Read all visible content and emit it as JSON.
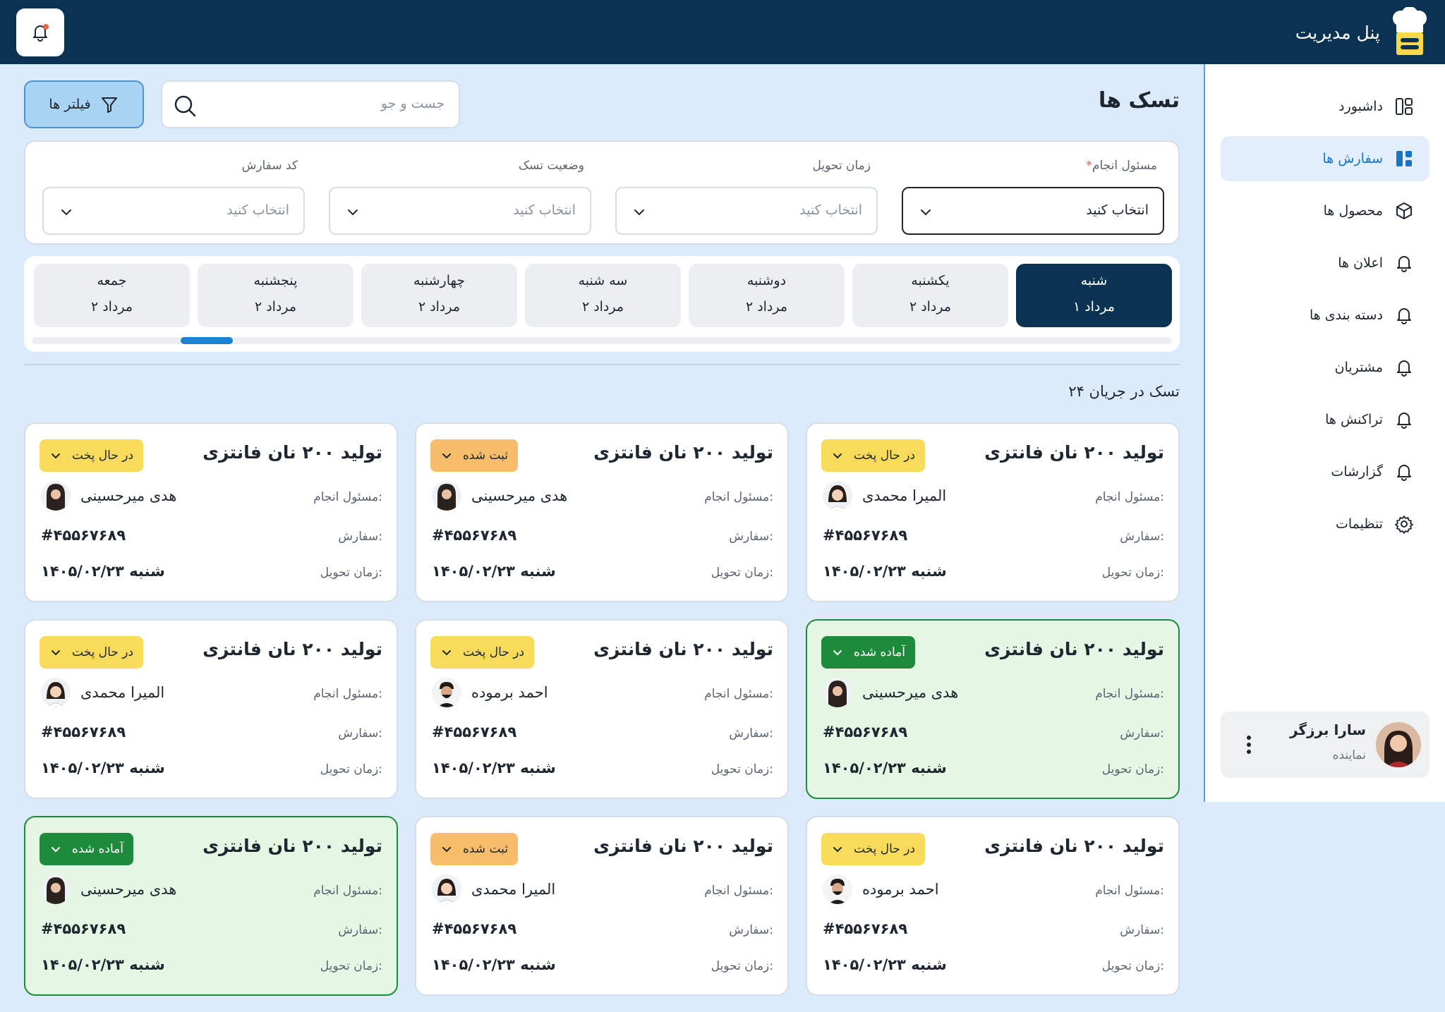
{
  "app": {
    "title": "پنل مدیریت"
  },
  "sidebar": {
    "items": [
      {
        "label": "داشبورد",
        "icon": "layout-icon",
        "active": false
      },
      {
        "label": "سفارش ها",
        "icon": "layout-icon",
        "active": true
      },
      {
        "label": "محصول ها",
        "icon": "box-icon",
        "active": false
      },
      {
        "label": "اعلان ها",
        "icon": "bell-icon",
        "active": false
      },
      {
        "label": "دسته بندی ها",
        "icon": "bell-icon",
        "active": false
      },
      {
        "label": "مشتریان",
        "icon": "bell-icon",
        "active": false
      },
      {
        "label": "تراکنش ها",
        "icon": "bell-icon",
        "active": false
      },
      {
        "label": "گزارشات",
        "icon": "bell-icon",
        "active": false
      },
      {
        "label": "تنظیمات",
        "icon": "gear-icon",
        "active": false
      }
    ]
  },
  "profile": {
    "name": "سارا برزگر",
    "role": "نماینده"
  },
  "page": {
    "title": "تسک ها",
    "search_placeholder": "جست و جو",
    "filter_button": "فیلتر ها",
    "count_label": "۲۴ تسک در جریان"
  },
  "filters": [
    {
      "label": "مسئول انجام",
      "required": "*",
      "value": "انتخاب کنید"
    },
    {
      "label": "زمان تحویل",
      "value": "انتخاب کنید"
    },
    {
      "label": "وضعیت تسک",
      "value": "انتخاب کنید"
    },
    {
      "label": "کد سفارش",
      "value": "انتخاب کنید"
    }
  ],
  "days": [
    {
      "name": "شنبه",
      "date": "۱ مرداد"
    },
    {
      "name": "یکشنبه",
      "date": "۲ مرداد"
    },
    {
      "name": "دوشنبه",
      "date": "۲ مرداد"
    },
    {
      "name": "سه شنبه",
      "date": "۲ مرداد"
    },
    {
      "name": "چهارشنبه",
      "date": "۲ مرداد"
    },
    {
      "name": "پنجشنبه",
      "date": "۲ مرداد"
    },
    {
      "name": "جمعه",
      "date": "۲ مرداد"
    }
  ],
  "card_labels": {
    "assignee": "مسئول انجام:",
    "order": "سفارش:",
    "delivery": "زمان تحویل:"
  },
  "tasks": [
    {
      "title": "تولید ۲۰۰ نان فانتزی",
      "status": "در حال پخت",
      "assignee": "المیرا محمدی",
      "order": "#۴۵۵۶۷۶۸۹",
      "delivery": "شنبه ۱۴۰۵/۰۲/۲۳"
    },
    {
      "title": "تولید ۲۰۰ نان فانتزی",
      "status": "ثبت شده",
      "assignee": "هدی میرحسینی",
      "order": "#۴۵۵۶۷۶۸۹",
      "delivery": "شنبه ۱۴۰۵/۰۲/۲۳"
    },
    {
      "title": "تولید ۲۰۰ نان فانتزی",
      "status": "در حال پخت",
      "assignee": "هدی میرحسینی",
      "order": "#۴۵۵۶۷۶۸۹",
      "delivery": "شنبه ۱۴۰۵/۰۲/۲۳"
    },
    {
      "title": "تولید ۲۰۰ نان فانتزی",
      "status": "آماده شده",
      "assignee": "هدی میرحسینی",
      "order": "#۴۵۵۶۷۶۸۹",
      "delivery": "شنبه ۱۴۰۵/۰۲/۲۳"
    },
    {
      "title": "تولید ۲۰۰ نان فانتزی",
      "status": "در حال پخت",
      "assignee": "احمد برموده",
      "order": "#۴۵۵۶۷۶۸۹",
      "delivery": "شنبه ۱۴۰۵/۰۲/۲۳"
    },
    {
      "title": "تولید ۲۰۰ نان فانتزی",
      "status": "در حال پخت",
      "assignee": "المیرا محمدی",
      "order": "#۴۵۵۶۷۶۸۹",
      "delivery": "شنبه ۱۴۰۵/۰۲/۲۳"
    },
    {
      "title": "تولید ۲۰۰ نان فانتزی",
      "status": "در حال پخت",
      "assignee": "احمد برموده",
      "order": "#۴۵۵۶۷۶۸۹",
      "delivery": "شنبه ۱۴۰۵/۰۲/۲۳"
    },
    {
      "title": "تولید ۲۰۰ نان فانتزی",
      "status": "ثبت شده",
      "assignee": "المیرا محمدی",
      "order": "#۴۵۵۶۷۶۸۹",
      "delivery": "شنبه ۱۴۰۵/۰۲/۲۳"
    },
    {
      "title": "تولید ۲۰۰ نان فانتزی",
      "status": "آماده شده",
      "assignee": "هدی میرحسینی",
      "order": "#۴۵۵۶۷۶۸۹",
      "delivery": "شنبه ۱۴۰۵/۰۲/۲۳"
    }
  ],
  "colors": {
    "topbar": "#0a3351",
    "accent": "#1476c9",
    "status_cooking": "#f9db5c",
    "status_registered": "#f7bd6a",
    "status_ready": "#1e8a3b",
    "ready_card_bg": "#e6f6e4"
  }
}
